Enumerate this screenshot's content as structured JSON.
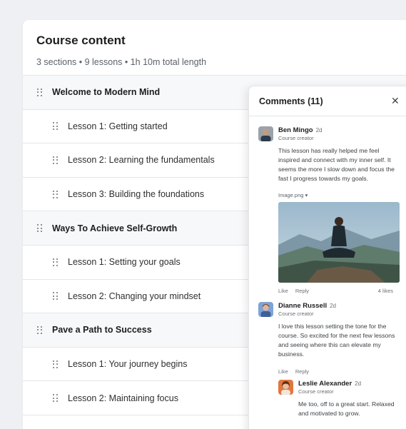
{
  "course": {
    "title": "Course content",
    "meta": "3 sections • 9 lessons • 1h 10m total length",
    "rows": [
      {
        "kind": "section",
        "label": "Welcome to Modern Mind"
      },
      {
        "kind": "lesson",
        "label": "Lesson 1: Getting started"
      },
      {
        "kind": "lesson",
        "label": "Lesson 2: Learning the fundamentals"
      },
      {
        "kind": "lesson",
        "label": "Lesson 3: Building the foundations"
      },
      {
        "kind": "section",
        "label": "Ways To Achieve Self-Growth"
      },
      {
        "kind": "lesson",
        "label": "Lesson 1: Setting your goals"
      },
      {
        "kind": "lesson",
        "label": "Lesson 2: Changing your mindset"
      },
      {
        "kind": "section",
        "label": "Pave a Path to Success"
      },
      {
        "kind": "lesson",
        "label": "Lesson 1: Your journey begins"
      },
      {
        "kind": "lesson",
        "label": "Lesson 2: Maintaining focus"
      }
    ]
  },
  "comments_panel": {
    "title": "Comments (11)",
    "close_icon": "close-icon",
    "comments": [
      {
        "name": "Ben Mingo",
        "time": "2d",
        "role": "Course creator",
        "body": "This lesson has really helped me feel inspired and connect with my inner self. It seems the more I slow down and focus the fast I progress towards my goals.",
        "attachment": "Image.png",
        "like": "Like",
        "reply": "Reply",
        "likes": "4 likes"
      },
      {
        "name": "Dianne Russell",
        "time": "2d",
        "role": "Course creator",
        "body": "I love this lesson setting the tone for the course. So excited for the next few lessons and seeing where this can elevate my business.",
        "like": "Like",
        "reply": "Reply"
      },
      {
        "name": "Leslie Alexander",
        "time": "2d",
        "role": "Course creator",
        "body": "Me too, off to a great start. Relaxed and motivated to grow."
      }
    ]
  }
}
